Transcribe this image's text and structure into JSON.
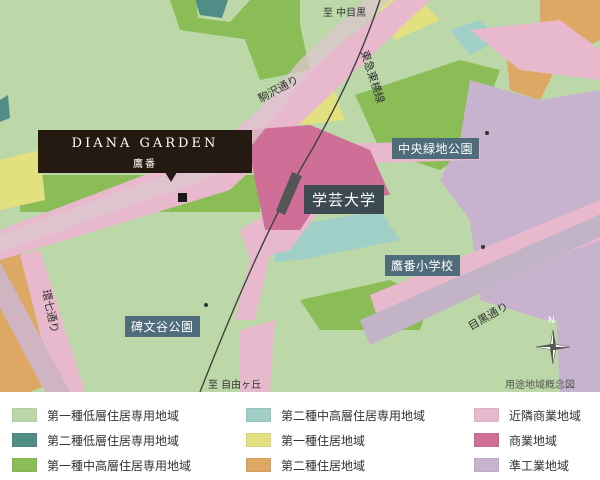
{
  "map": {
    "property": {
      "name": "DIANA GARDEN",
      "sub": "鷹番"
    },
    "station": "学芸大学",
    "places": {
      "park_chuo": "中央緑地公園",
      "school": "鷹番小学校",
      "park_himon": "碑文谷公園"
    },
    "roads": {
      "komazawa": "駒沢通り",
      "toyoko": "東急東横線",
      "kan7": "環七通り",
      "meguro": "目黒通り"
    },
    "destinations": {
      "north": "至 中目黒",
      "south": "至 自由ヶ丘"
    },
    "compass_letter": "N",
    "caption": "用途地域概念図"
  },
  "legend": {
    "items": [
      {
        "label": "第一種低層住居専用地域",
        "color": "#bcd8a8"
      },
      {
        "label": "第二種中高層住居専用地域",
        "color": "#9fcfc6"
      },
      {
        "label": "近隣商業地域",
        "color": "#e8b9cc"
      },
      {
        "label": "第二種低層住居専用地域",
        "color": "#4f8d86"
      },
      {
        "label": "第一種住居地域",
        "color": "#e2e07f"
      },
      {
        "label": "商業地域",
        "color": "#cf6f98"
      },
      {
        "label": "第一種中高層住居専用地域",
        "color": "#8bbd57"
      },
      {
        "label": "第二種住居地域",
        "color": "#dca863"
      },
      {
        "label": "準工業地域",
        "color": "#c7b3cd"
      }
    ]
  }
}
